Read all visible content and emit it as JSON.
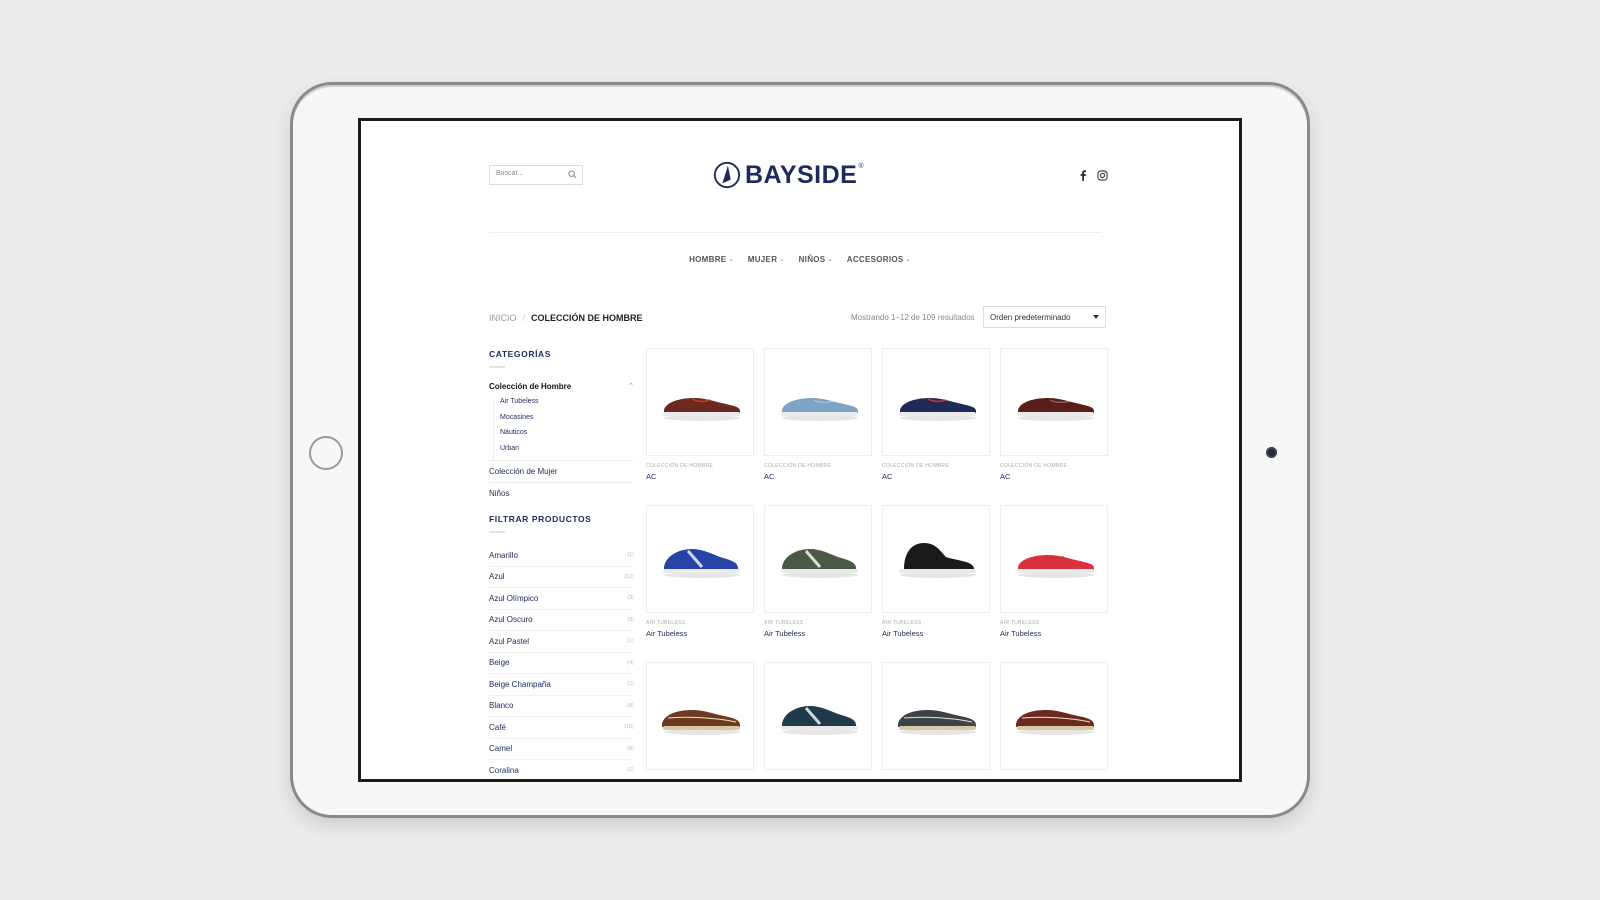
{
  "site": {
    "brand": "BAYSIDE",
    "brand_reg": "®",
    "search_placeholder": "Buscar...",
    "nav": [
      {
        "label": "HOMBRE"
      },
      {
        "label": "MUJER"
      },
      {
        "label": "NIÑOS"
      },
      {
        "label": "ACCESORIOS"
      }
    ],
    "social": [
      "facebook-icon",
      "instagram-icon"
    ]
  },
  "breadcrumb": {
    "home": "INICIO",
    "separator": "/",
    "current": "COLECCIÓN DE HOMBRE"
  },
  "results_text": "Mostrando 1–12 de 109 resultados",
  "sort": {
    "selected": "Orden predeterminado"
  },
  "sidebar": {
    "categories_title": "CATEGORÍAS",
    "active_category": "Colección de Hombre",
    "subcategories": [
      "Air Tubeless",
      "Mocasines",
      "Náuticos",
      "Urban"
    ],
    "other_categories": [
      "Colección de Mujer",
      "Niños"
    ],
    "filter_title": "FILTRAR PRODUCTOS",
    "filters": [
      {
        "label": "Amarillo",
        "count": "(1)"
      },
      {
        "label": "Azul",
        "count": "(12)"
      },
      {
        "label": "Azul Olímpico",
        "count": "(3)"
      },
      {
        "label": "Azul Oscuro",
        "count": "(3)"
      },
      {
        "label": "Azul Pastel",
        "count": "(1)"
      },
      {
        "label": "Beige",
        "count": "(4)"
      },
      {
        "label": "Beige Champaña",
        "count": "(2)"
      },
      {
        "label": "Blanco",
        "count": "(8)"
      },
      {
        "label": "Café",
        "count": "(16)"
      },
      {
        "label": "Camel",
        "count": "(6)"
      },
      {
        "label": "Coralina",
        "count": "(1)"
      }
    ]
  },
  "products": [
    {
      "category": "COLECCIÓN DE HOMBRE",
      "name": "AC",
      "color": "#6b2a1e",
      "style": "loafer-lace"
    },
    {
      "category": "COLECCIÓN DE HOMBRE",
      "name": "AC",
      "color": "#7ea3c4",
      "style": "loafer"
    },
    {
      "category": "COLECCIÓN DE HOMBRE",
      "name": "AC",
      "color": "#1f2a55",
      "style": "loafer-lace"
    },
    {
      "category": "COLECCIÓN DE HOMBRE",
      "name": "AC",
      "color": "#5a1e1a",
      "style": "loafer"
    },
    {
      "category": "AIR TUBELESS",
      "name": "Air Tubeless",
      "color": "#2743a8",
      "style": "sneaker"
    },
    {
      "category": "AIR TUBELESS",
      "name": "Air Tubeless",
      "color": "#4a5a45",
      "style": "sneaker"
    },
    {
      "category": "AIR TUBELESS",
      "name": "Air Tubeless",
      "color": "#1a1a1a",
      "style": "boot"
    },
    {
      "category": "AIR TUBELESS",
      "name": "Air Tubeless",
      "color": "#d9323d",
      "style": "loafer-lace"
    },
    {
      "category": "",
      "name": "",
      "color": "#6e3b22",
      "style": "boat"
    },
    {
      "category": "",
      "name": "",
      "color": "#1f3a48",
      "style": "sneaker"
    },
    {
      "category": "",
      "name": "",
      "color": "#3c4448",
      "style": "boat"
    },
    {
      "category": "",
      "name": "",
      "color": "#6a2a20",
      "style": "boat"
    }
  ]
}
